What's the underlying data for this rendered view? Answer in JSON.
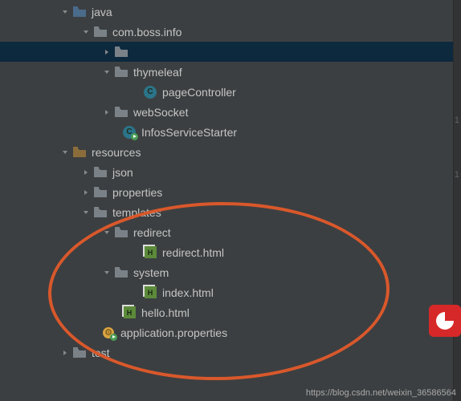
{
  "tree": {
    "java": "java",
    "comBossInfo": "com.boss.info",
    "pkg1": "",
    "thymeleaf": "thymeleaf",
    "pageController": "pageController",
    "webSocket": "webSocket",
    "infosServiceStarter": "InfosServiceStarter",
    "resources": "resources",
    "json": "json",
    "properties": "properties",
    "templates": "templates",
    "redirect": "redirect",
    "redirectHtml": "redirect.html",
    "system": "system",
    "indexHtml": "index.html",
    "helloHtml": "hello.html",
    "appProps": "application.properties",
    "test": "test"
  },
  "watermark": "https://blog.csdn.net/weixin_36586564",
  "gutter": {
    "a": "1",
    "b": "1"
  }
}
